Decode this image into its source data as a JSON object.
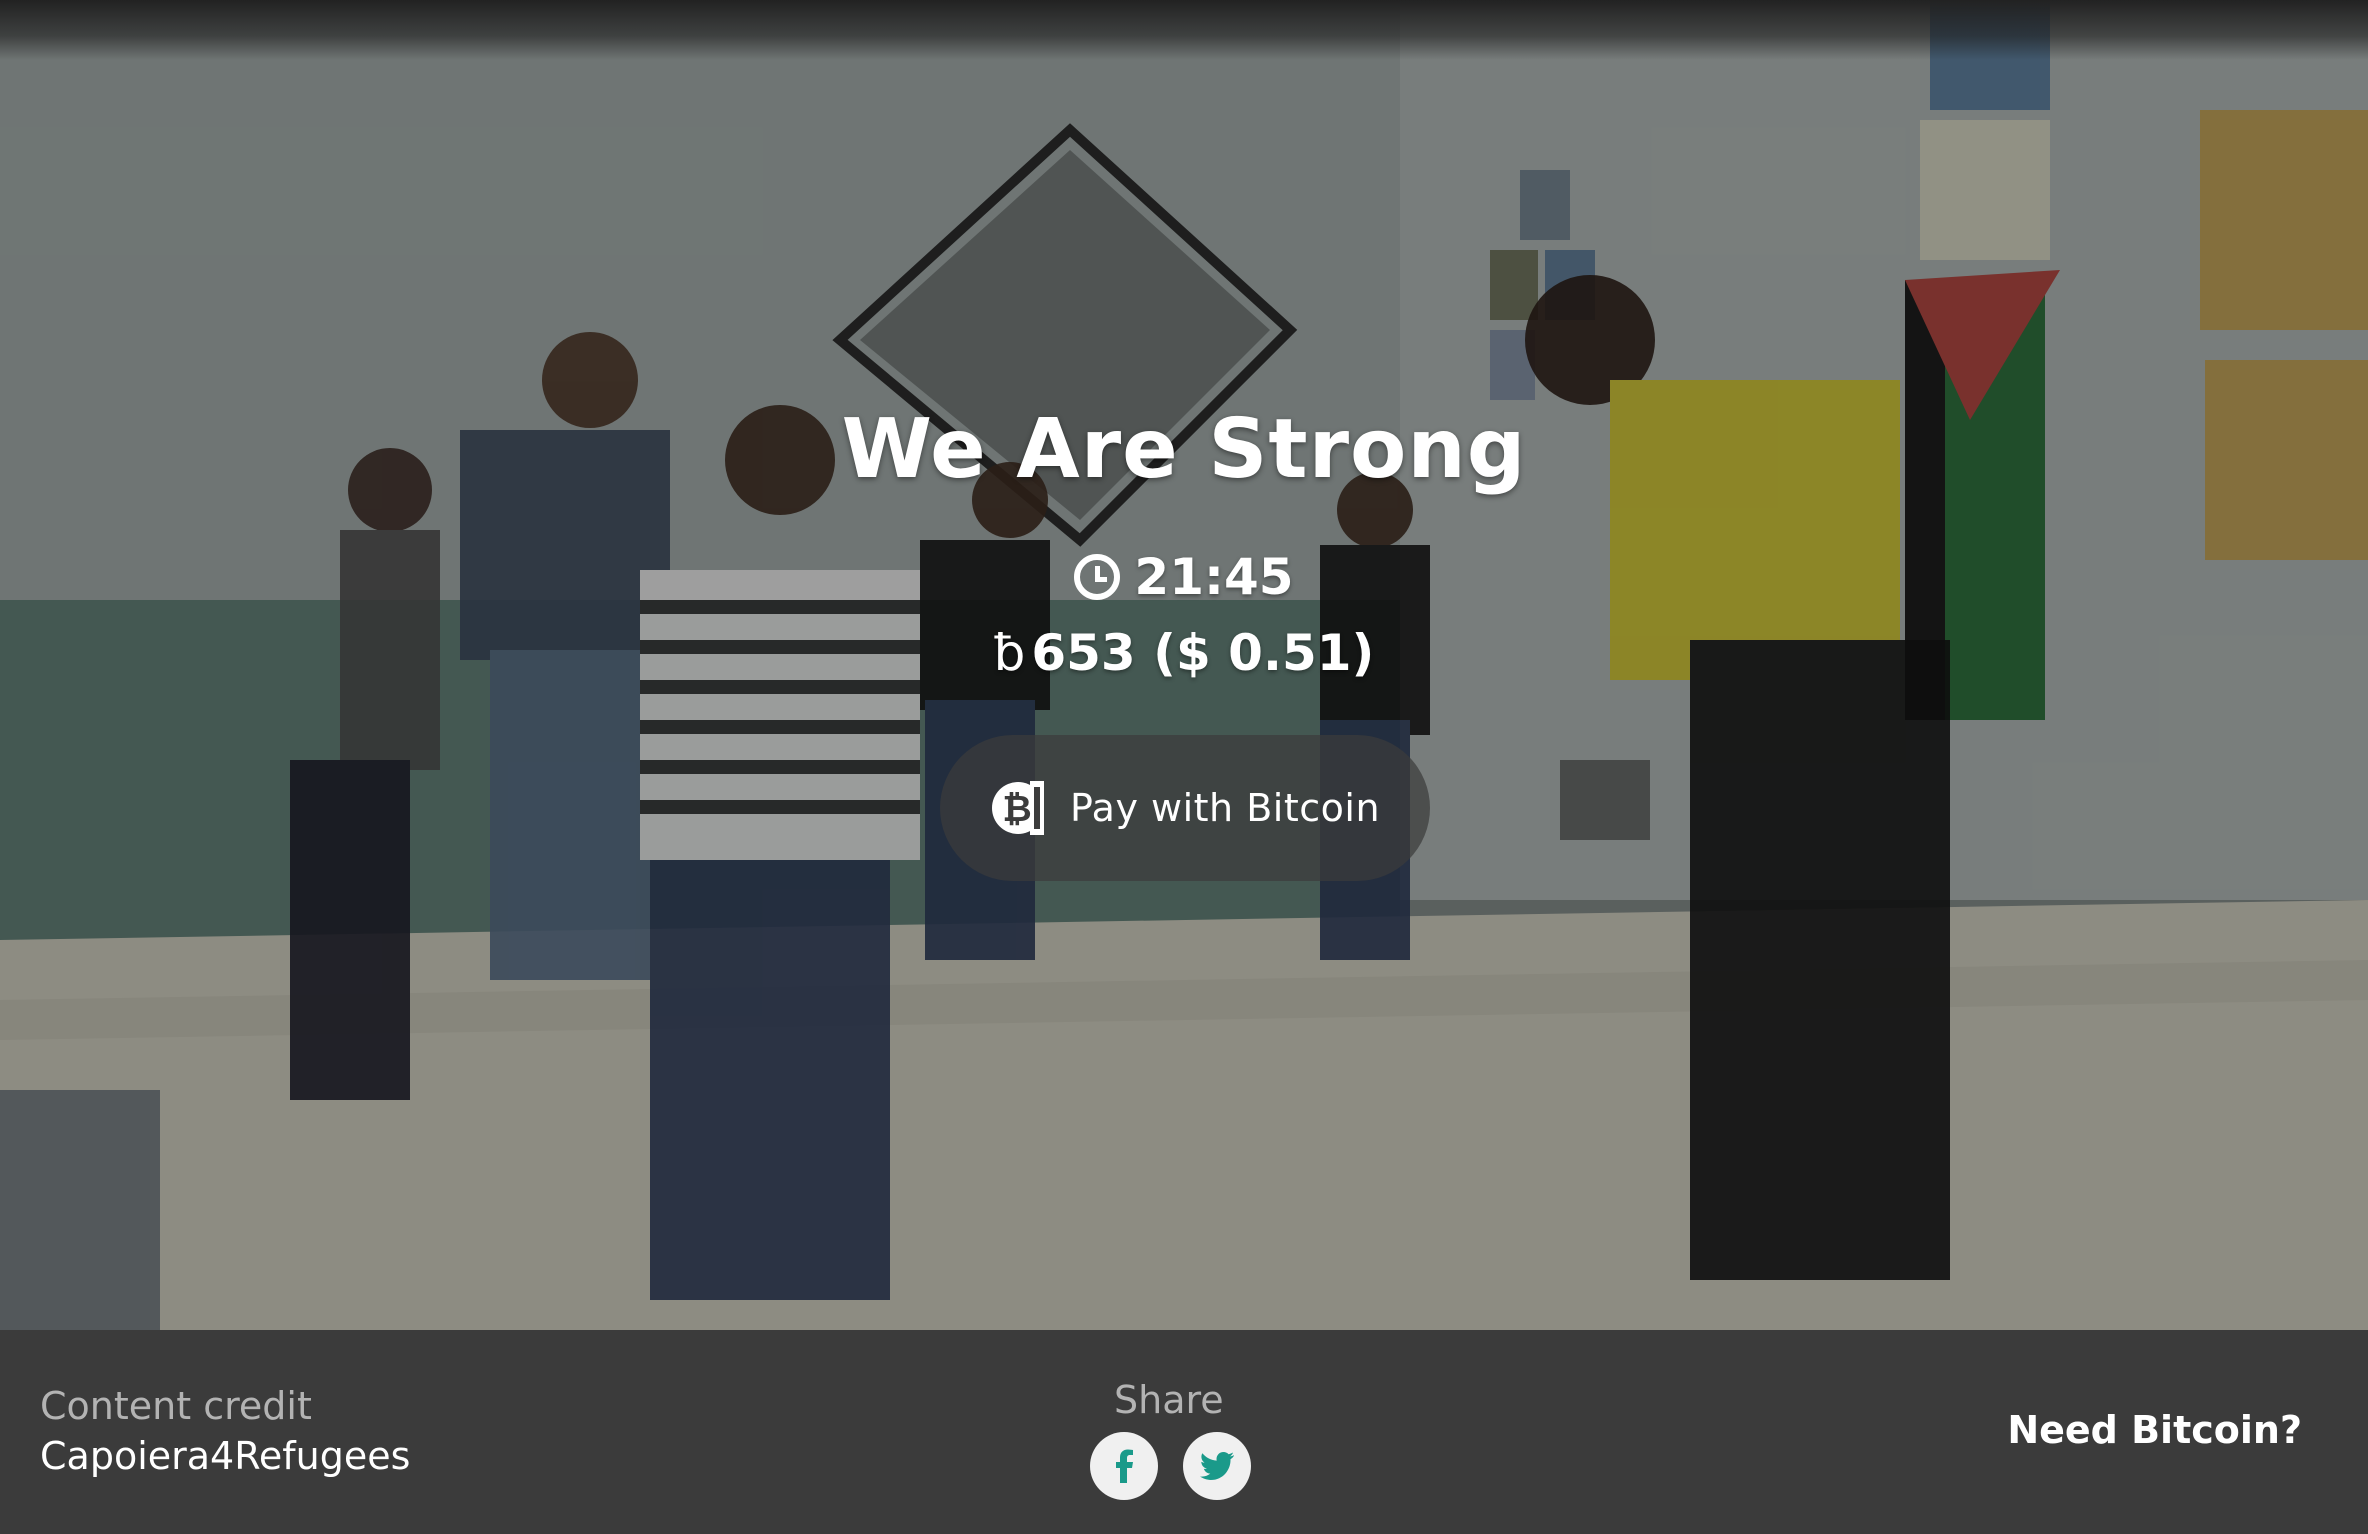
{
  "video": {
    "title": "We Are Strong",
    "duration": "21:45",
    "price_symbol": "ƀ",
    "price": "653 ($ 0.51)",
    "pay_button_label": "Pay with Bitcoin"
  },
  "footer": {
    "credit_label": "Content credit",
    "credit_name": "Capoiera4Refugees",
    "share_label": "Share",
    "need_bitcoin_label": "Need Bitcoin?"
  },
  "colors": {
    "footer_bg": "#3b3b3b",
    "share_icon": "#1a9a8a"
  },
  "icons": [
    "clock-icon",
    "bitcoin-icon",
    "facebook-icon",
    "twitter-icon"
  ]
}
